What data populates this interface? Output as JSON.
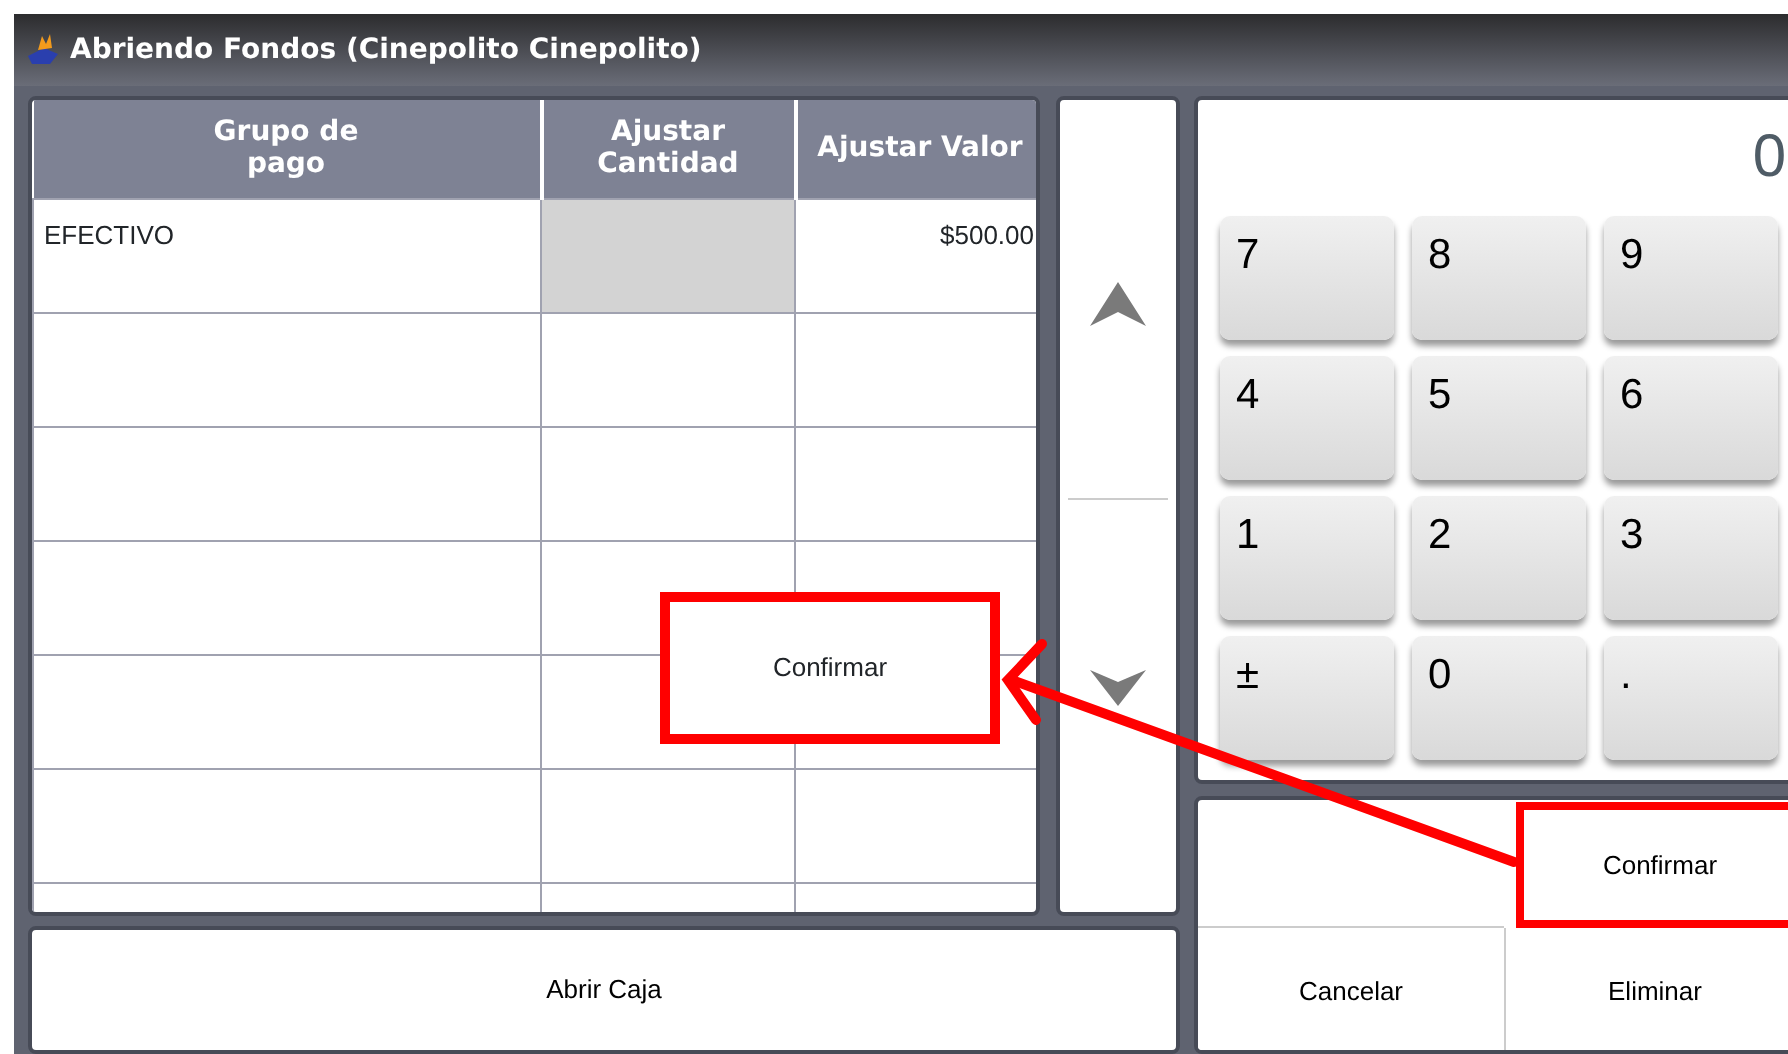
{
  "window": {
    "title": "Abriendo Fondos (Cinepolito  Cinepolito)"
  },
  "table": {
    "columns": [
      "Grupo de pago",
      "Ajustar Cantidad",
      "Ajustar Valor"
    ],
    "rows": [
      {
        "grupo": "EFECTIVO",
        "cantidad_disabled": true,
        "valor": "$500.00"
      }
    ]
  },
  "display": "0",
  "keypad": [
    "7",
    "8",
    "9",
    "4",
    "5",
    "6",
    "1",
    "2",
    "3",
    "±",
    "0",
    "."
  ],
  "actions": [
    {
      "label": "Confirmar",
      "highlighted": true
    },
    {
      "label": "Cancelar",
      "highlighted": false
    },
    {
      "label": "Eliminar",
      "highlighted": false
    }
  ],
  "open_button": "Abrir Caja",
  "callout": {
    "label": "Confirmar"
  }
}
